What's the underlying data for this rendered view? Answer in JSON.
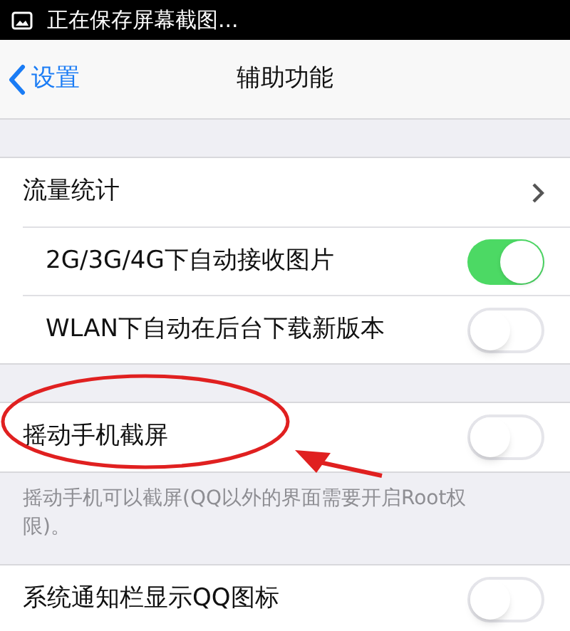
{
  "status_bar": {
    "text": "正在保存屏幕截图..."
  },
  "nav_bar": {
    "back": "设置",
    "title": "辅助功能"
  },
  "groups": [
    {
      "rows": [
        {
          "kind": "link",
          "label": "流量统计"
        },
        {
          "kind": "switch",
          "label": "2G/3G/4G下自动接收图片",
          "on": true
        },
        {
          "kind": "switch",
          "label": "WLAN下自动在后台下载新版本",
          "on": false
        }
      ]
    },
    {
      "rows": [
        {
          "kind": "switch",
          "label": "摇动手机截屏",
          "on": false
        }
      ],
      "footer": "摇动手机可以截屏(QQ以外的界面需要开启Root权限)。"
    },
    {
      "rows": [
        {
          "kind": "switch",
          "label": "系统通知栏显示QQ图标",
          "on": false
        }
      ]
    }
  ]
}
